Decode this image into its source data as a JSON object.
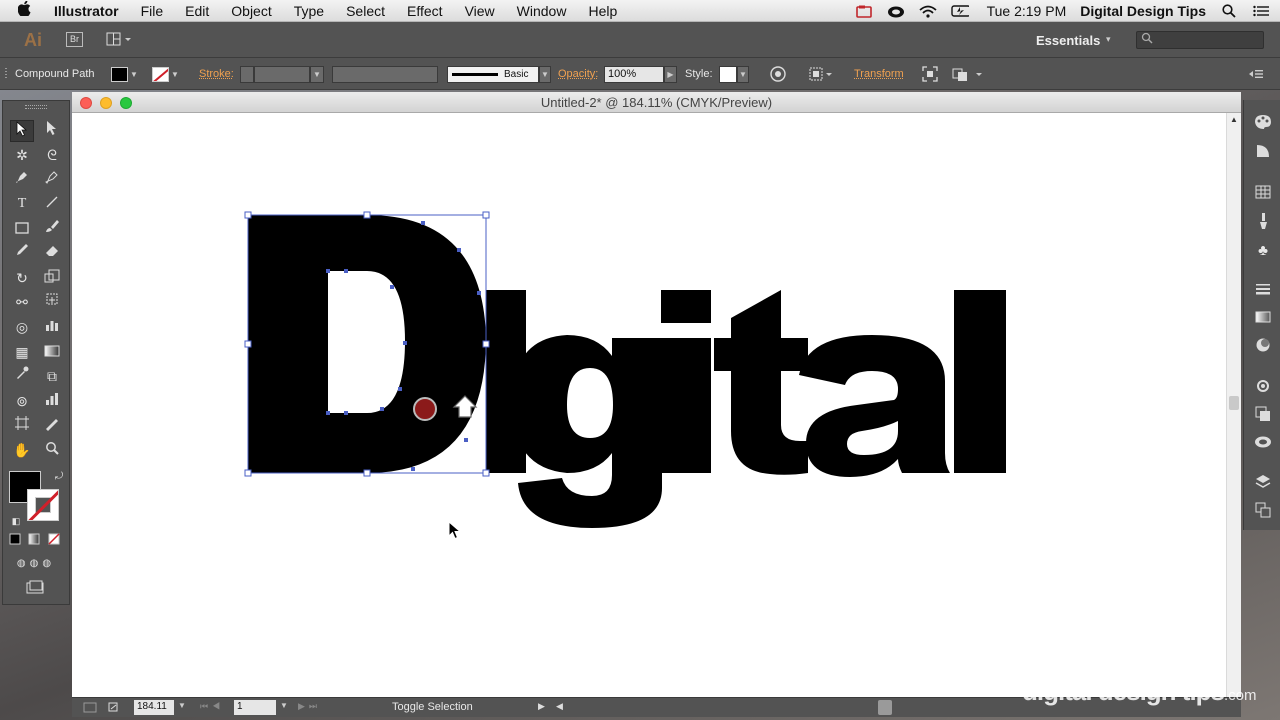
{
  "menubar": {
    "app_name": "Illustrator",
    "items": [
      "File",
      "Edit",
      "Object",
      "Type",
      "Select",
      "Effect",
      "View",
      "Window",
      "Help"
    ],
    "clock": "Tue 2:19 PM",
    "user": "Digital Design Tips"
  },
  "appbar": {
    "logo": "Ai",
    "bridge": "Br",
    "workspace": "Essentials",
    "search_placeholder": ""
  },
  "controlbar": {
    "selection_label": "Compound Path",
    "stroke_label": "Stroke:",
    "brush_label": "Basic",
    "opacity_label": "Opacity:",
    "opacity_value": "100%",
    "style_label": "Style:",
    "transform_label": "Transform"
  },
  "document": {
    "title": "Untitled-2* @ 184.11% (CMYK/Preview)",
    "artwork_text": "Digital"
  },
  "statusbar": {
    "zoom": "184.11",
    "page": "1",
    "toggle_label": "Toggle Selection"
  },
  "watermark": {
    "main": "digital design tips",
    "suffix": ".com"
  },
  "colors": {
    "accent_orange": "#f0a150",
    "fill": "#000000",
    "selection_blue": "#4a5fc4",
    "ui_gray": "#535353"
  }
}
